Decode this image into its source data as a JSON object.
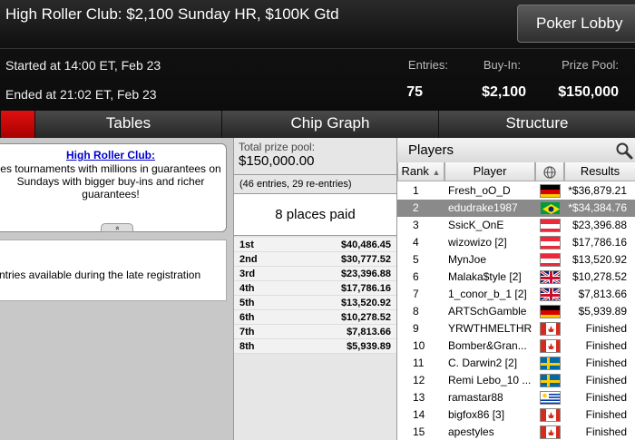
{
  "header": {
    "title": "High Roller Club: $2,100 Sunday HR, $100K Gtd",
    "lobby_button": "Poker Lobby",
    "started": "Started at 14:00 ET, Feb 23",
    "ended": "Ended at 21:02 ET, Feb 23",
    "stats": {
      "entries_label": "Entries:",
      "entries_value": "75",
      "buyin_label": "Buy-In:",
      "buyin_value": "$2,100",
      "pool_label": "Prize Pool:",
      "pool_value": "$150,000"
    }
  },
  "tabs": [
    {
      "label": "",
      "active": true
    },
    {
      "label": "Tables",
      "active": false
    },
    {
      "label": "Chip Graph",
      "active": false
    },
    {
      "label": "Structure",
      "active": false
    }
  ],
  "left": {
    "link": "High Roller Club:",
    "description": "es tournaments with millions in guarantees on Sundays with bigger buy-ins and richer guarantees!",
    "expand_glyph": "»",
    "late_reg": "ntries available during the late registration"
  },
  "prize": {
    "label": "Total prize pool:",
    "amount": "$150,000.00",
    "entries_note": "(46 entries, 29 re-entries)",
    "places_paid": "8 places paid",
    "payouts": [
      {
        "place": "1st",
        "amount": "$40,486.45"
      },
      {
        "place": "2nd",
        "amount": "$30,777.52"
      },
      {
        "place": "3rd",
        "amount": "$23,396.88"
      },
      {
        "place": "4th",
        "amount": "$17,786.16"
      },
      {
        "place": "5th",
        "amount": "$13,520.92"
      },
      {
        "place": "6th",
        "amount": "$10,278.52"
      },
      {
        "place": "7th",
        "amount": "$7,813.66"
      },
      {
        "place": "8th",
        "amount": "$5,939.89"
      }
    ]
  },
  "players": {
    "title": "Players",
    "columns": {
      "rank": "Rank",
      "player": "Player",
      "results": "Results"
    },
    "rows": [
      {
        "rank": "1",
        "name": "Fresh_oO_D",
        "flag": "de",
        "result": "*$36,879.21",
        "selected": false
      },
      {
        "rank": "2",
        "name": "edudrake1987",
        "flag": "br",
        "result": "*$34,384.76",
        "selected": true
      },
      {
        "rank": "3",
        "name": "SsicK_OnE",
        "flag": "at",
        "result": "$23,396.88",
        "selected": false
      },
      {
        "rank": "4",
        "name": "wizowizo [2]",
        "flag": "at",
        "result": "$17,786.16",
        "selected": false
      },
      {
        "rank": "5",
        "name": "MynJoe",
        "flag": "at",
        "result": "$13,520.92",
        "selected": false
      },
      {
        "rank": "6",
        "name": "Malaka$tyle [2]",
        "flag": "gb",
        "result": "$10,278.52",
        "selected": false
      },
      {
        "rank": "7",
        "name": "1_conor_b_1 [2]",
        "flag": "gb",
        "result": "$7,813.66",
        "selected": false
      },
      {
        "rank": "8",
        "name": "ARTSchGamble",
        "flag": "de",
        "result": "$5,939.89",
        "selected": false
      },
      {
        "rank": "9",
        "name": "YRWTHMELTHR",
        "flag": "ca",
        "result": "Finished",
        "selected": false
      },
      {
        "rank": "10",
        "name": "Bomber&Gran...",
        "flag": "ca",
        "result": "Finished",
        "selected": false
      },
      {
        "rank": "11",
        "name": "C. Darwin2 [2]",
        "flag": "se",
        "result": "Finished",
        "selected": false
      },
      {
        "rank": "12",
        "name": "Remi Lebo_10 ...",
        "flag": "se",
        "result": "Finished",
        "selected": false
      },
      {
        "rank": "13",
        "name": "ramastar88",
        "flag": "uy",
        "result": "Finished",
        "selected": false
      },
      {
        "rank": "14",
        "name": "bigfox86 [3]",
        "flag": "ca",
        "result": "Finished",
        "selected": false
      },
      {
        "rank": "15",
        "name": "apestyles",
        "flag": "ca",
        "result": "Finished",
        "selected": false
      }
    ]
  },
  "colors": {
    "active_tab": "#c80808",
    "selected_row": "#8a8a8a",
    "link": "#0000cc"
  }
}
